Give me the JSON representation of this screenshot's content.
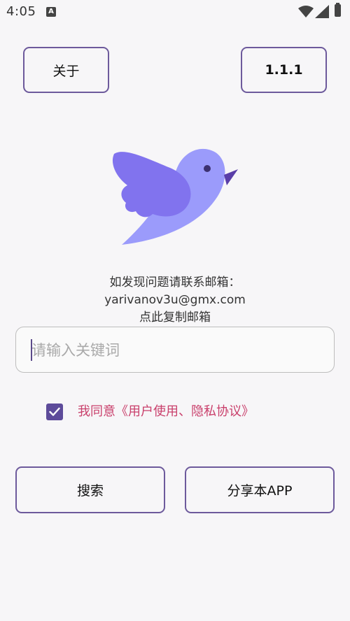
{
  "status_bar": {
    "time": "4:05",
    "a_icon": "A",
    "icons": [
      "wifi-icon",
      "signal-icon",
      "battery-icon"
    ]
  },
  "top_buttons": {
    "about_label": "关于",
    "version_label": "1.1.1"
  },
  "contact": {
    "line1": "如发现问题请联系邮箱：",
    "email": "yarivanov3u@gmx.com",
    "line3": "点此复制邮箱"
  },
  "search": {
    "placeholder": "请输入关键词",
    "value": ""
  },
  "agreement": {
    "checked": true,
    "label": "我同意《用户使用、隐私协议》"
  },
  "bottom_buttons": {
    "search_label": "搜索",
    "share_label": "分享本APP"
  },
  "colors": {
    "accent": "#6d5a9c",
    "checkbox": "#5d4b9a",
    "agreement_text": "#c93f6b",
    "bird_body": "#9b9bfb",
    "bird_wing": "#8173ee"
  }
}
